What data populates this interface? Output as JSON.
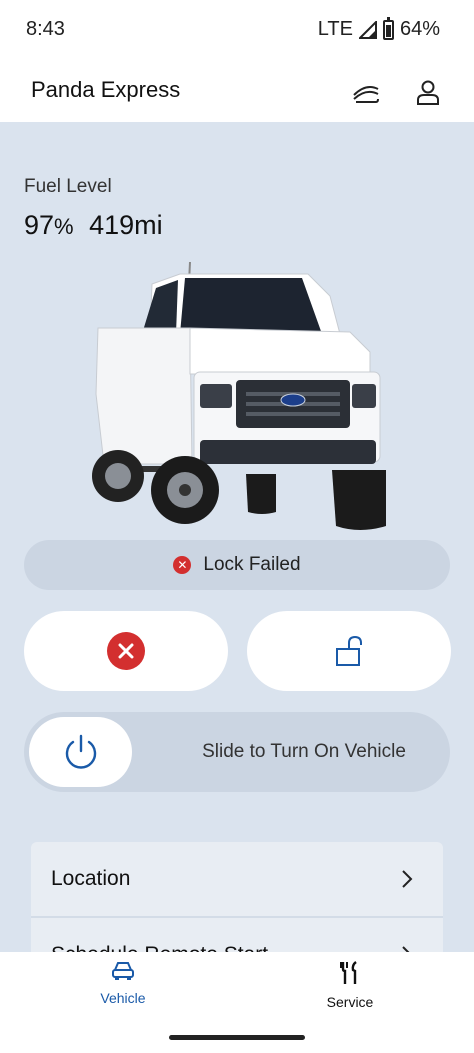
{
  "status_bar": {
    "time": "8:43",
    "network": "LTE",
    "battery": "64%"
  },
  "header": {
    "title": "Panda Express",
    "icons": [
      "vehicle-switch-icon",
      "account-icon"
    ]
  },
  "fuel": {
    "label": "Fuel Level",
    "percent": "97",
    "percent_unit": "%",
    "range": "419mi"
  },
  "lock_status": {
    "text": "Lock Failed"
  },
  "actions": {
    "lock_failed_icon": "x-circle-icon",
    "unlock_icon": "unlock-icon"
  },
  "slider": {
    "text": "Slide to Turn On Vehicle"
  },
  "list": {
    "items": [
      "Location",
      "Schedule Remote Start"
    ]
  },
  "bottom_nav": {
    "items": [
      {
        "label": "Vehicle",
        "active": true
      },
      {
        "label": "Service",
        "active": false
      }
    ]
  },
  "colors": {
    "accent": "#1a5aa8",
    "error": "#d32f2f",
    "background": "#dae3ee"
  }
}
